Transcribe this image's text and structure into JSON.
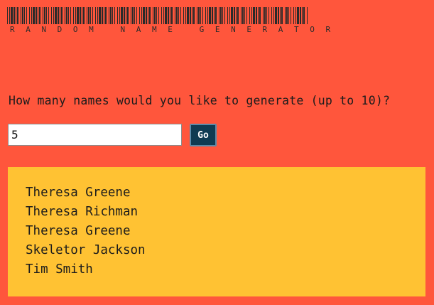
{
  "header": {
    "title": "RANDOM NAME GENERATOR"
  },
  "prompt": {
    "question": "How many names would you like to generate (up to 10)?"
  },
  "form": {
    "count_value": "5",
    "go_label": "Go"
  },
  "results": {
    "names": [
      "Theresa Greene",
      "Theresa Richman",
      "Theresa Greene",
      "Skeletor Jackson",
      "Tim Smith"
    ]
  },
  "colors": {
    "page_background": "#ff563c",
    "results_background": "#ffc233",
    "button_background": "#0f3b52"
  }
}
